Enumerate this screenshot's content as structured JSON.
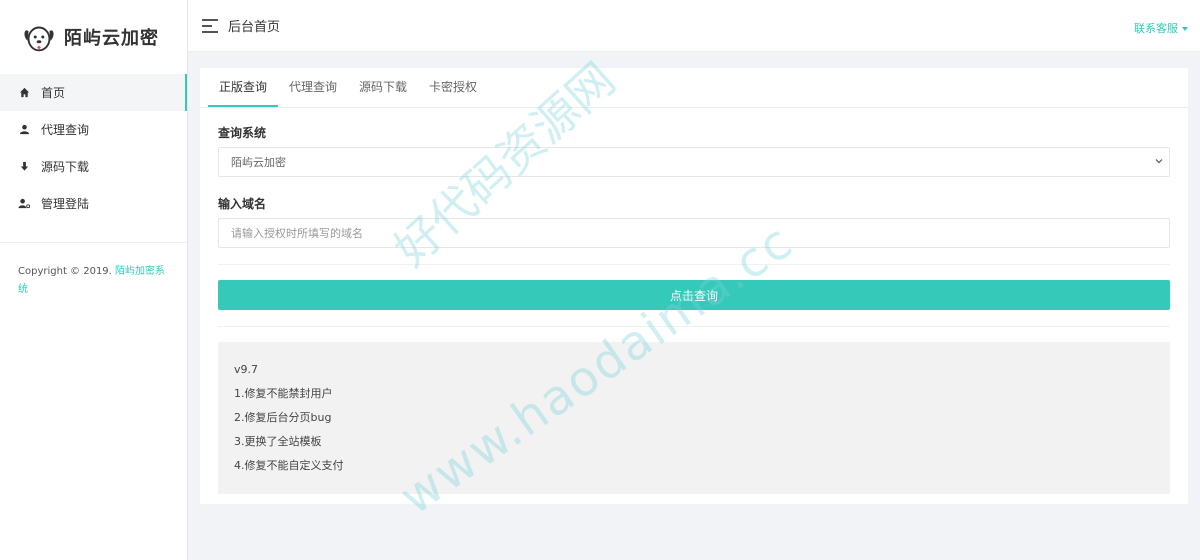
{
  "brand": {
    "logo_text": "陌屿云加密",
    "accent": "#35c9b9"
  },
  "header": {
    "title": "后台首页",
    "contact": "联系客服"
  },
  "sidebar": {
    "items": [
      {
        "label": "首页",
        "icon": "home-icon",
        "active": true
      },
      {
        "label": "代理查询",
        "icon": "user-icon"
      },
      {
        "label": "源码下载",
        "icon": "download-icon"
      },
      {
        "label": "管理登陆",
        "icon": "admin-icon"
      }
    ],
    "copyright_prefix": "Copyright © 2019. ",
    "copyright_link": "陌屿加密系统"
  },
  "tabs": [
    {
      "label": "正版查询",
      "active": true
    },
    {
      "label": "代理查询"
    },
    {
      "label": "源码下载"
    },
    {
      "label": "卡密授权"
    }
  ],
  "form": {
    "system_label": "查询系统",
    "system_value": "陌屿云加密",
    "domain_label": "输入域名",
    "domain_placeholder": "请输入授权时所填写的域名",
    "submit_label": "点击查询"
  },
  "notes": [
    "v9.7",
    "1.修复不能禁封用户",
    "2.修复后台分页bug",
    "3.更换了全站模板",
    "4.修复不能自定义支付"
  ],
  "watermark": {
    "line1": "好代码资源网",
    "line2": "www.haodaima.cc"
  }
}
